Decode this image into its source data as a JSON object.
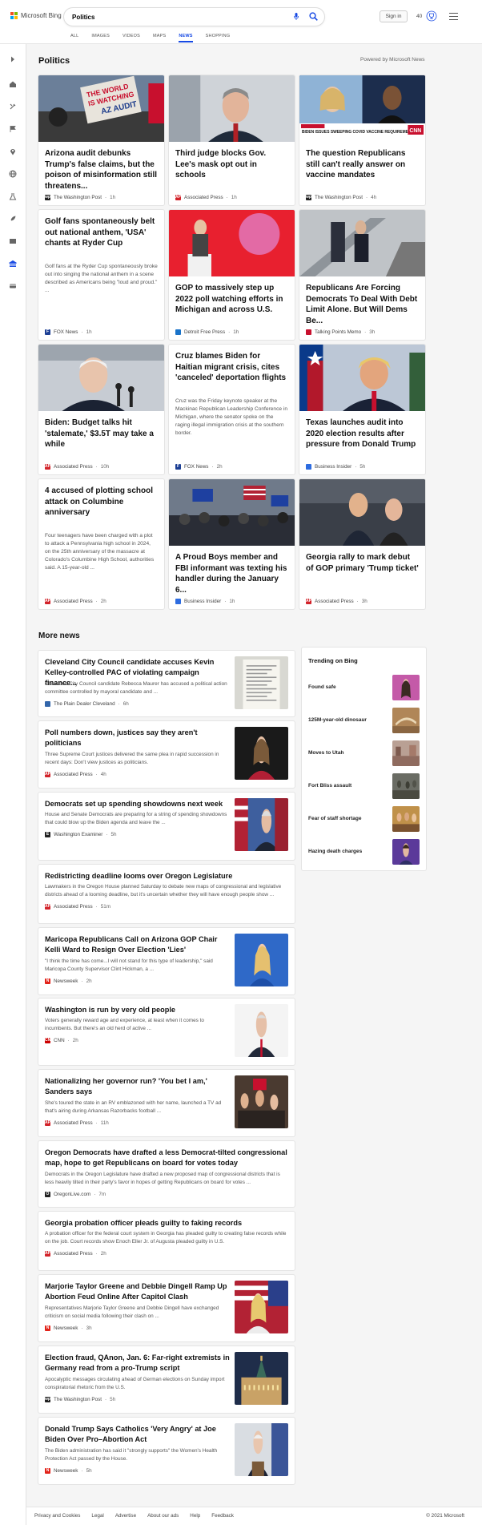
{
  "header": {
    "brand": "Microsoft Bing",
    "query": "Politics",
    "tabs": [
      "ALL",
      "IMAGES",
      "VIDEOS",
      "MAPS",
      "NEWS",
      "SHOPPING"
    ],
    "active_tab": "NEWS",
    "signin_label": "Sign in",
    "reward_points": "40",
    "accent_color": "#174ae4"
  },
  "section": {
    "title": "Politics",
    "powered_by": "Powered by Microsoft News"
  },
  "cards": [
    {
      "title": "Arizona audit debunks Trump's false claims, but the poison of misinformation still threatens...",
      "description": "",
      "source": "The Washington Post",
      "ago": "1h",
      "fav_color": "#222222",
      "fav_text": "wp",
      "image": "protest-sign-icon"
    },
    {
      "title": "Third judge blocks Gov. Lee's mask opt out in schools",
      "description": "",
      "source": "Associated Press",
      "ago": "1h",
      "fav_color": "#d2232a",
      "fav_text": "AP",
      "image": "governor-portrait-icon"
    },
    {
      "title": "The question Republicans still can't really answer on vaccine mandates",
      "description": "",
      "source": "The Washington Post",
      "ago": "4h",
      "fav_color": "#222222",
      "fav_text": "wp",
      "image": "cnn-panel-icon"
    },
    {
      "title": "Golf fans spontaneously belt out national anthem, 'USA' chants at Ryder Cup",
      "description": "Golf fans at the Ryder Cup spontaneously broke out into singing the national anthem in a scene described as Americans being \"loud and proud.\" ...",
      "source": "FOX News",
      "ago": "1h",
      "fav_color": "#1c3f94",
      "fav_text": "F",
      "image": ""
    },
    {
      "title": "GOP to massively step up 2022 poll watching efforts in Michigan and across U.S.",
      "description": "",
      "source": "Detroit Free Press",
      "ago": "1h",
      "fav_color": "#1a73c9",
      "fav_text": "",
      "image": "podium-speaker-icon"
    },
    {
      "title": "Republicans Are Forcing Democrats To Deal With Debt Limit Alone. But Will Dems Be...",
      "description": "",
      "source": "Talking Points Memo",
      "ago": "3h",
      "fav_color": "#c8102e",
      "fav_text": "",
      "image": "escalator-icon"
    },
    {
      "title": "Biden: Budget talks hit 'stalemate,' $3.5T may take a while",
      "description": "",
      "source": "Associated Press",
      "ago": "10h",
      "fav_color": "#d2232a",
      "fav_text": "AP",
      "image": "biden-portrait-icon"
    },
    {
      "title": "Cruz blames Biden for Haitian migrant crisis, cites 'canceled' deportation flights",
      "description": "Cruz was the Friday keynote speaker at the Mackinac Republican Leadership Conference in Michigan, where the senator spoke on the raging illegal immigration crisis at the southern border.",
      "source": "FOX News",
      "ago": "2h",
      "fav_color": "#1c3f94",
      "fav_text": "F",
      "image": ""
    },
    {
      "title": "Texas launches audit into 2020 election results after pressure from Donald Trump",
      "description": "",
      "source": "Business Insider",
      "ago": "5h",
      "fav_color": "#2d6ce0",
      "fav_text": "",
      "image": "trump-portrait-icon"
    },
    {
      "title": "4 accused of plotting school attack on Columbine anniversary",
      "description": "Four teenagers have been charged with a plot to attack a Pennsylvania high school in 2024, on the 25th anniversary of the massacre at Colorado's Columbine High School, authorities said. A 15-year-old ...",
      "source": "Associated Press",
      "ago": "2h",
      "fav_color": "#d2232a",
      "fav_text": "AP",
      "image": ""
    },
    {
      "title": "A Proud Boys member and FBI informant was texting his handler during the January 6...",
      "description": "",
      "source": "Business Insider",
      "ago": "1h",
      "fav_color": "#2d6ce0",
      "fav_text": "",
      "image": "crowd-flags-icon"
    },
    {
      "title": "Georgia rally to mark debut of GOP primary 'Trump ticket'",
      "description": "",
      "source": "Associated Press",
      "ago": "3h",
      "fav_color": "#d2232a",
      "fav_text": "AP",
      "image": "rally-stage-icon"
    }
  ],
  "more_news": {
    "title": "More news",
    "items": [
      {
        "title": "Cleveland City Council candidate accuses Kevin Kelley-controlled PAC of violating campaign finance...",
        "description": "Cleveland City Council candidate Rebecca Maurer has accused a political action committee controlled by mayoral candidate and ...",
        "source": "The Plain Dealer Cleveland",
        "ago": "6h",
        "fav_color": "#3366aa",
        "fav_text": "",
        "thumb": "document-icon"
      },
      {
        "title": "Poll numbers down, justices say they aren't politicians",
        "description": "Three Supreme Court justices delivered the same plea in rapid succession in recent days: Don't view justices as politicians.",
        "source": "Associated Press",
        "ago": "4h",
        "fav_color": "#d2232a",
        "fav_text": "AP",
        "thumb": "justice-portrait-icon"
      },
      {
        "title": "Democrats set up spending showdowns next week",
        "description": "House and Senate Democrats are preparing for a string of spending showdowns that could blow up the Biden agenda and leave the ...",
        "source": "Washington Examiner",
        "ago": "5h",
        "fav_color": "#222222",
        "fav_text": "E",
        "thumb": "capitol-flags-icon"
      },
      {
        "title": "Redistricting deadline looms over Oregon Legislature",
        "description": "Lawmakers in the Oregon House planned Saturday to debate new maps of congressional and legislative districts ahead of a looming deadline, but it's uncertain whether they will have enough people show ...",
        "source": "Associated Press",
        "ago": "51m",
        "fav_color": "#d2232a",
        "fav_text": "AP",
        "thumb": ""
      },
      {
        "title": "Maricopa Republicans Call on Arizona GOP Chair Kelli Ward to Resign Over Election 'Lies'",
        "description": "\"I think the time has come...I will not stand for this type of leadership,\" said Maricopa County Supervisor Clint Hickman, a ...",
        "source": "Newsweek",
        "ago": "2h",
        "fav_color": "#e2231a",
        "fav_text": "N",
        "thumb": "woman-blue-portrait-icon"
      },
      {
        "title": "Washington is run by very old people",
        "description": "Voters generally reward age and experience, at least when it comes to incumbents. But there's an old herd of active ...",
        "source": "CNN",
        "ago": "2h",
        "fav_color": "#cc0000",
        "fav_text": "CNN",
        "thumb": "senator-portrait-icon"
      },
      {
        "title": "Nationalizing her governor run? 'You bet I am,' Sanders says",
        "description": "She's toured the state in an RV emblazoned with her name, launched a TV ad that's airing during Arkansas Razorbacks football ...",
        "source": "Associated Press",
        "ago": "11h",
        "fav_color": "#d2232a",
        "fav_text": "AP",
        "thumb": "crowd-event-icon"
      },
      {
        "title": "Oregon Democrats have drafted a less Democrat-tilted congressional map, hope to get Republicans on board for votes today",
        "description": "Democrats in the Oregon Legislature have drafted a new proposed map of congressional districts that is less heavily tilted in their party's favor in hopes of getting Republicans on board for votes ...",
        "source": "OregonLive.com",
        "ago": "7m",
        "fav_color": "#222222",
        "fav_text": "O",
        "thumb": ""
      },
      {
        "title": "Georgia probation officer pleads guilty to faking records",
        "description": "A probation officer for the federal court system in Georgia has pleaded guilty to creating false records while on the job. Court records show Enoch Eller Jr. of Augusta pleaded guilty in U.S.",
        "source": "Associated Press",
        "ago": "2h",
        "fav_color": "#d2232a",
        "fav_text": "AP",
        "thumb": ""
      },
      {
        "title": "Marjorie Taylor Greene and Debbie Dingell Ramp Up Abortion Feud Online After Capitol Clash",
        "description": "Representatives Marjorie Taylor Greene and Debbie Dingell have exchanged criticism on social media following their clash on ...",
        "source": "Newsweek",
        "ago": "3h",
        "fav_color": "#e2231a",
        "fav_text": "N",
        "thumb": "flag-portrait-icon"
      },
      {
        "title": "Election fraud, QAnon, Jan. 6: Far-right extremists in Germany read from a pro-Trump script",
        "description": "Apocalyptic messages circulating ahead of German elections on Sunday import conspiratorial rhetoric from the U.S.",
        "source": "The Washington Post",
        "ago": "5h",
        "fav_color": "#222222",
        "fav_text": "wp",
        "thumb": "palace-night-icon"
      },
      {
        "title": "Donald Trump Says Catholics 'Very Angry' at Joe Biden Over Pro–Abortion Act",
        "description": "The Biden administration has said it \"strongly supports\" the Women's Health Protection Act passed by the House.",
        "source": "Newsweek",
        "ago": "5h",
        "fav_color": "#e2231a",
        "fav_text": "N",
        "thumb": "biden-podium-icon"
      }
    ]
  },
  "trending": {
    "title": "Trending on Bing",
    "items": [
      {
        "label": "Found safe",
        "thumb": "woman-portrait-icon"
      },
      {
        "label": "125M-year-old dinosaur",
        "thumb": "fossil-icon"
      },
      {
        "label": "Moves to Utah",
        "thumb": "street-scene-icon"
      },
      {
        "label": "Fort Bliss assault",
        "thumb": "soldiers-icon"
      },
      {
        "label": "Fear of staff shortage",
        "thumb": "group-photo-icon"
      },
      {
        "label": "Hazing death charges",
        "thumb": "student-portrait-icon"
      }
    ]
  },
  "footer": {
    "links": [
      "Privacy and Cookies",
      "Legal",
      "Advertise",
      "About our ads",
      "Help",
      "Feedback"
    ],
    "copyright": "© 2021 Microsoft"
  }
}
